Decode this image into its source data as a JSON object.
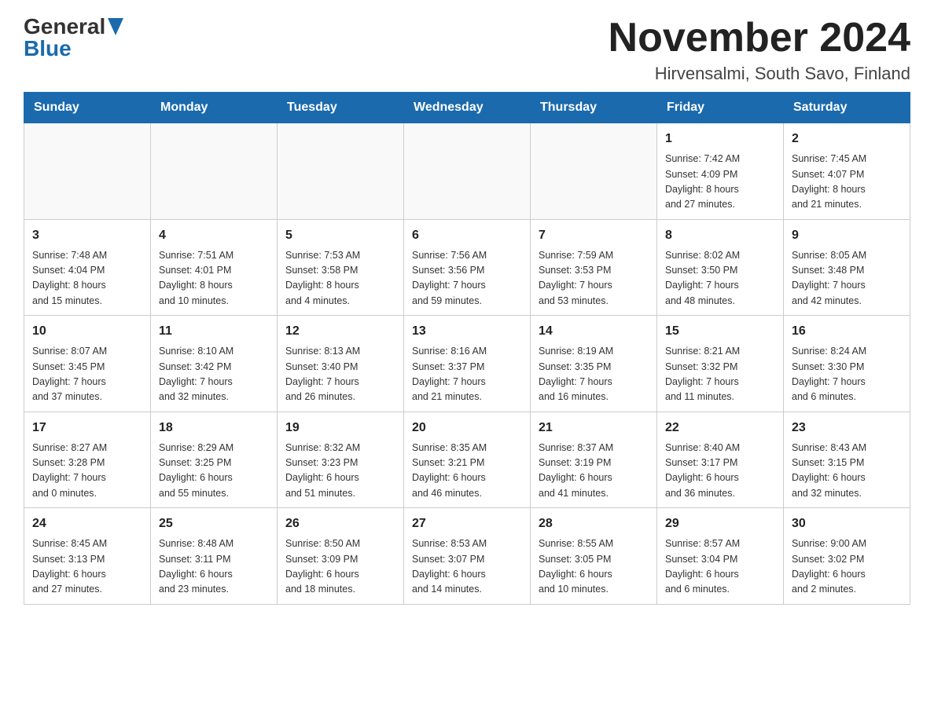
{
  "header": {
    "logo": {
      "general": "General",
      "blue": "Blue"
    },
    "title": "November 2024",
    "location": "Hirvensalmi, South Savo, Finland"
  },
  "calendar": {
    "days_of_week": [
      "Sunday",
      "Monday",
      "Tuesday",
      "Wednesday",
      "Thursday",
      "Friday",
      "Saturday"
    ],
    "weeks": [
      {
        "days": [
          {
            "number": "",
            "info": ""
          },
          {
            "number": "",
            "info": ""
          },
          {
            "number": "",
            "info": ""
          },
          {
            "number": "",
            "info": ""
          },
          {
            "number": "",
            "info": ""
          },
          {
            "number": "1",
            "info": "Sunrise: 7:42 AM\nSunset: 4:09 PM\nDaylight: 8 hours\nand 27 minutes."
          },
          {
            "number": "2",
            "info": "Sunrise: 7:45 AM\nSunset: 4:07 PM\nDaylight: 8 hours\nand 21 minutes."
          }
        ]
      },
      {
        "days": [
          {
            "number": "3",
            "info": "Sunrise: 7:48 AM\nSunset: 4:04 PM\nDaylight: 8 hours\nand 15 minutes."
          },
          {
            "number": "4",
            "info": "Sunrise: 7:51 AM\nSunset: 4:01 PM\nDaylight: 8 hours\nand 10 minutes."
          },
          {
            "number": "5",
            "info": "Sunrise: 7:53 AM\nSunset: 3:58 PM\nDaylight: 8 hours\nand 4 minutes."
          },
          {
            "number": "6",
            "info": "Sunrise: 7:56 AM\nSunset: 3:56 PM\nDaylight: 7 hours\nand 59 minutes."
          },
          {
            "number": "7",
            "info": "Sunrise: 7:59 AM\nSunset: 3:53 PM\nDaylight: 7 hours\nand 53 minutes."
          },
          {
            "number": "8",
            "info": "Sunrise: 8:02 AM\nSunset: 3:50 PM\nDaylight: 7 hours\nand 48 minutes."
          },
          {
            "number": "9",
            "info": "Sunrise: 8:05 AM\nSunset: 3:48 PM\nDaylight: 7 hours\nand 42 minutes."
          }
        ]
      },
      {
        "days": [
          {
            "number": "10",
            "info": "Sunrise: 8:07 AM\nSunset: 3:45 PM\nDaylight: 7 hours\nand 37 minutes."
          },
          {
            "number": "11",
            "info": "Sunrise: 8:10 AM\nSunset: 3:42 PM\nDaylight: 7 hours\nand 32 minutes."
          },
          {
            "number": "12",
            "info": "Sunrise: 8:13 AM\nSunset: 3:40 PM\nDaylight: 7 hours\nand 26 minutes."
          },
          {
            "number": "13",
            "info": "Sunrise: 8:16 AM\nSunset: 3:37 PM\nDaylight: 7 hours\nand 21 minutes."
          },
          {
            "number": "14",
            "info": "Sunrise: 8:19 AM\nSunset: 3:35 PM\nDaylight: 7 hours\nand 16 minutes."
          },
          {
            "number": "15",
            "info": "Sunrise: 8:21 AM\nSunset: 3:32 PM\nDaylight: 7 hours\nand 11 minutes."
          },
          {
            "number": "16",
            "info": "Sunrise: 8:24 AM\nSunset: 3:30 PM\nDaylight: 7 hours\nand 6 minutes."
          }
        ]
      },
      {
        "days": [
          {
            "number": "17",
            "info": "Sunrise: 8:27 AM\nSunset: 3:28 PM\nDaylight: 7 hours\nand 0 minutes."
          },
          {
            "number": "18",
            "info": "Sunrise: 8:29 AM\nSunset: 3:25 PM\nDaylight: 6 hours\nand 55 minutes."
          },
          {
            "number": "19",
            "info": "Sunrise: 8:32 AM\nSunset: 3:23 PM\nDaylight: 6 hours\nand 51 minutes."
          },
          {
            "number": "20",
            "info": "Sunrise: 8:35 AM\nSunset: 3:21 PM\nDaylight: 6 hours\nand 46 minutes."
          },
          {
            "number": "21",
            "info": "Sunrise: 8:37 AM\nSunset: 3:19 PM\nDaylight: 6 hours\nand 41 minutes."
          },
          {
            "number": "22",
            "info": "Sunrise: 8:40 AM\nSunset: 3:17 PM\nDaylight: 6 hours\nand 36 minutes."
          },
          {
            "number": "23",
            "info": "Sunrise: 8:43 AM\nSunset: 3:15 PM\nDaylight: 6 hours\nand 32 minutes."
          }
        ]
      },
      {
        "days": [
          {
            "number": "24",
            "info": "Sunrise: 8:45 AM\nSunset: 3:13 PM\nDaylight: 6 hours\nand 27 minutes."
          },
          {
            "number": "25",
            "info": "Sunrise: 8:48 AM\nSunset: 3:11 PM\nDaylight: 6 hours\nand 23 minutes."
          },
          {
            "number": "26",
            "info": "Sunrise: 8:50 AM\nSunset: 3:09 PM\nDaylight: 6 hours\nand 18 minutes."
          },
          {
            "number": "27",
            "info": "Sunrise: 8:53 AM\nSunset: 3:07 PM\nDaylight: 6 hours\nand 14 minutes."
          },
          {
            "number": "28",
            "info": "Sunrise: 8:55 AM\nSunset: 3:05 PM\nDaylight: 6 hours\nand 10 minutes."
          },
          {
            "number": "29",
            "info": "Sunrise: 8:57 AM\nSunset: 3:04 PM\nDaylight: 6 hours\nand 6 minutes."
          },
          {
            "number": "30",
            "info": "Sunrise: 9:00 AM\nSunset: 3:02 PM\nDaylight: 6 hours\nand 2 minutes."
          }
        ]
      }
    ]
  }
}
